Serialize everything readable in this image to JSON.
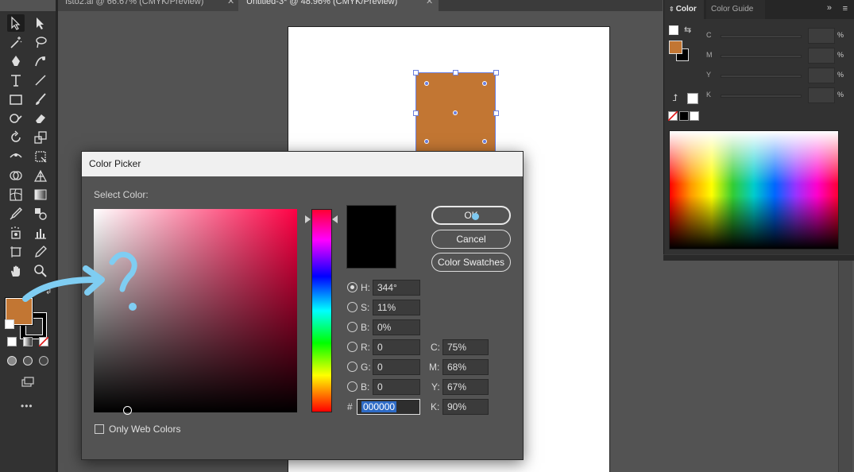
{
  "tabs": [
    {
      "label": "Isto2.ai @ 66.67% (CMYK/Preview)"
    },
    {
      "label": "Untitled-3* @ 48.96% (CMYK/Preview)"
    }
  ],
  "color_panel": {
    "tab_active": "Color",
    "tab_inactive": "Color Guide",
    "collapse_glyph": "»",
    "menu_glyph": "≡",
    "rows": [
      {
        "label": "C",
        "unit": "%"
      },
      {
        "label": "M",
        "unit": "%"
      },
      {
        "label": "Y",
        "unit": "%"
      },
      {
        "label": "K",
        "unit": "%"
      }
    ],
    "fill_color": "#c27633"
  },
  "toolbar": {
    "fill_color": "#c27633",
    "stroke_color": "#000000",
    "more_glyph": "•••"
  },
  "dialog": {
    "title": "Color Picker",
    "select_label": "Select Color:",
    "ok_label": "OK",
    "cancel_label": "Cancel",
    "swatches_label": "Color Swatches",
    "only_web_label": "Only Web Colors",
    "hash_label": "#",
    "hsb": [
      {
        "label": "H:",
        "value": "344°",
        "selected": true
      },
      {
        "label": "S:",
        "value": "11%",
        "selected": false
      },
      {
        "label": "B:",
        "value": "0%",
        "selected": false
      }
    ],
    "rgb": [
      {
        "label": "R:",
        "value": "0"
      },
      {
        "label": "G:",
        "value": "0"
      },
      {
        "label": "B:",
        "value": "0"
      }
    ],
    "cmyk": [
      {
        "label": "C:",
        "value": "75%"
      },
      {
        "label": "M:",
        "value": "68%"
      },
      {
        "label": "Y:",
        "value": "67%"
      },
      {
        "label": "K:",
        "value": "90%"
      }
    ],
    "hex_value": "000000",
    "preview_color": "#000000"
  },
  "artboard": {
    "object_color": "#c27633"
  }
}
